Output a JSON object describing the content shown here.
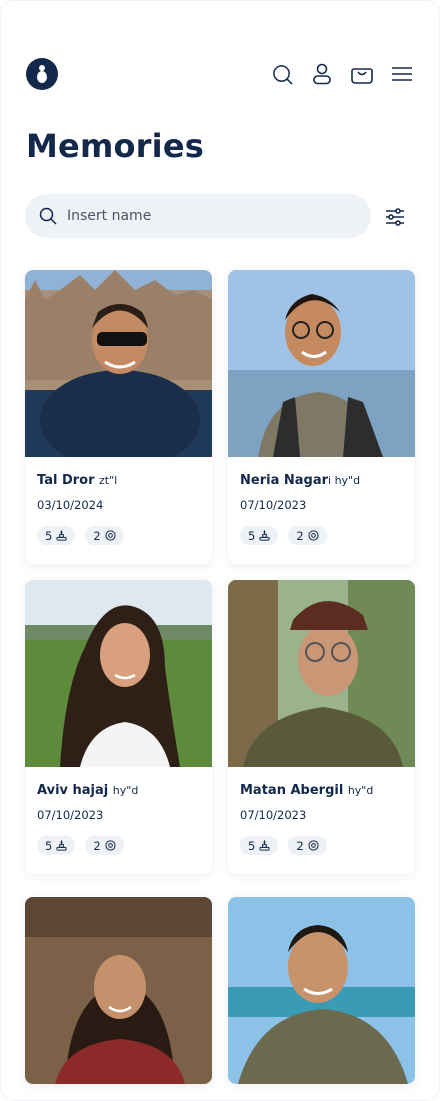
{
  "header": {
    "logo_alt": "logo",
    "icons": [
      "search-icon",
      "user-icon",
      "cart-icon",
      "menu-icon"
    ]
  },
  "page_title": "Memories",
  "search": {
    "placeholder": "Insert name",
    "value": ""
  },
  "memorials": [
    {
      "name": "Tal Dror",
      "suffix": "zt\"l",
      "date": "03/10/2024",
      "candles": "5",
      "flowers": "2"
    },
    {
      "name": "Neria Nagar",
      "suffix": "i hy\"d",
      "date": "07/10/2023",
      "candles": "5",
      "flowers": "2"
    },
    {
      "name": "Aviv hajaj",
      "suffix": "hy\"d",
      "date": "07/10/2023",
      "candles": "5",
      "flowers": "2"
    },
    {
      "name": "Matan Abergil",
      "suffix": "hy\"d",
      "date": "07/10/2023",
      "candles": "5",
      "flowers": "2"
    },
    {
      "name": "",
      "suffix": "",
      "date": "",
      "candles": "",
      "flowers": ""
    },
    {
      "name": "",
      "suffix": "",
      "date": "",
      "candles": "",
      "flowers": ""
    }
  ],
  "colors": {
    "primary": "#13284a",
    "badge_bg": "#eef2f7",
    "search_bg": "#eef2f7"
  }
}
